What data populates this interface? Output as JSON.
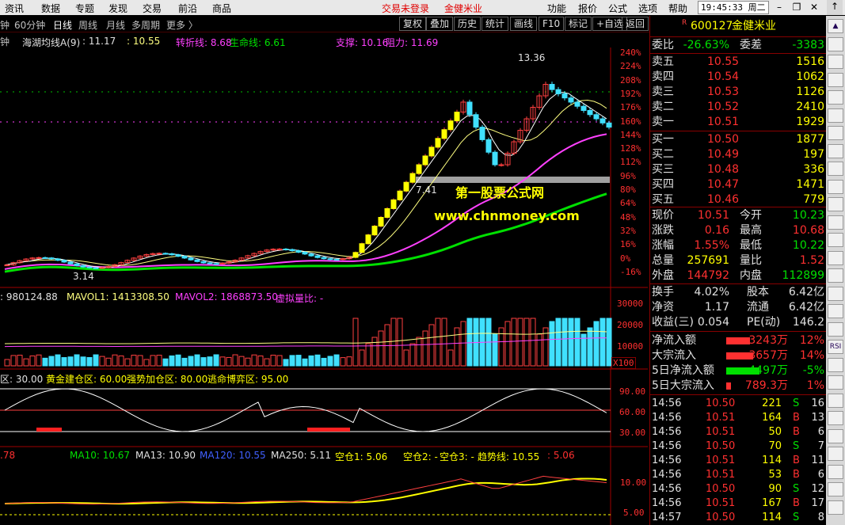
{
  "menu": {
    "items": [
      "资讯",
      "数据",
      "专题",
      "发现",
      "交易",
      "前沿",
      "商品"
    ],
    "status1": "交易未登录",
    "status2": "金健米业",
    "right": [
      "功能",
      "报价",
      "公式",
      "选项",
      "帮助"
    ],
    "time": "19:45:33",
    "day": "周二"
  },
  "periods": {
    "p0": "钟",
    "p1": "60分钟",
    "p2": "日线",
    "p3": "周线",
    "p4": "月线",
    "p5": "多周期",
    "p6": "更多 〉"
  },
  "toolbar": [
    "复权",
    "叠加",
    "历史",
    "统计",
    "画线",
    "F10",
    "标记",
    "+自选",
    "返回"
  ],
  "main_ind": {
    "name": "海湖均线A(9)",
    "v1": ": 11.17",
    "v2": ": 10.55",
    "v3": "转折线: 8.68",
    "v4": "生命线: 6.61",
    "v5": "支撑: 10.16",
    "v6": "阻力: 11.69"
  },
  "pct_axis": [
    "240%",
    "224%",
    "208%",
    "192%",
    "176%",
    "160%",
    "144%",
    "128%",
    "112%",
    "96%",
    "80%",
    "64%",
    "48%",
    "32%",
    "16%",
    "0%",
    "-16%"
  ],
  "price_labels": {
    "high": "13.36",
    "low": "3.14",
    "mid": "7.41"
  },
  "watermark": {
    "line1": "第一股票公式网",
    "line2": "www.chnmoney.com"
  },
  "vol_ind": {
    "v0": ": 980124.88",
    "v1": "MAVOL1: 1413308.50",
    "v2": "MAVOL2: 1868873.50",
    "v3": "虚拟量比: -"
  },
  "vol_axis": [
    "30000",
    "20000",
    "10000",
    "X100"
  ],
  "osc_ind": {
    "v0": "区: 30.00",
    "v1": "黄金建仓区: 60.00",
    "v2": "强势加仓区: 80.00",
    "v3": "逃命博弈区: 95.00"
  },
  "osc_axis": [
    "90.00",
    "60.00",
    "30.00"
  ],
  "ma_ind": {
    "v0": ".78",
    "v1": "MA10: 10.67",
    "v2": "MA13: 10.90",
    "v3": "MA120: 10.55",
    "v4": "MA250: 5.11",
    "v5": "空仓1: 5.06",
    "v6": "空仓2: -",
    "v7": "空仓3: -",
    "v8": "趋势线: 10.55",
    "v9": ": 5.06"
  },
  "ma_axis": [
    "10.00",
    "5.00"
  ],
  "stock": {
    "flag": "R",
    "code": "600127",
    "name": "金健米业"
  },
  "weibi": {
    "l1": "委比",
    "v1": "-26.63%",
    "l2": "委差",
    "v2": "-3383"
  },
  "asks": [
    {
      "l": "卖五",
      "p": "10.55",
      "v": "1516"
    },
    {
      "l": "卖四",
      "p": "10.54",
      "v": "1062"
    },
    {
      "l": "卖三",
      "p": "10.53",
      "v": "1126"
    },
    {
      "l": "卖二",
      "p": "10.52",
      "v": "2410"
    },
    {
      "l": "卖一",
      "p": "10.51",
      "v": "1929"
    }
  ],
  "bids": [
    {
      "l": "买一",
      "p": "10.50",
      "v": "1877"
    },
    {
      "l": "买二",
      "p": "10.49",
      "v": "197"
    },
    {
      "l": "买三",
      "p": "10.48",
      "v": "336"
    },
    {
      "l": "买四",
      "p": "10.47",
      "v": "1471"
    },
    {
      "l": "买五",
      "p": "10.46",
      "v": "779"
    }
  ],
  "quote": [
    {
      "l1": "现价",
      "v1": "10.51",
      "l2": "今开",
      "v2": "10.23"
    },
    {
      "l1": "涨跌",
      "v1": "0.16",
      "l2": "最高",
      "v2": "10.68"
    },
    {
      "l1": "涨幅",
      "v1": "1.55%",
      "l2": "最低",
      "v2": "10.22"
    },
    {
      "l1": "总量",
      "v1": "257691",
      "l2": "量比",
      "v2": "1.52"
    },
    {
      "l1": "外盘",
      "v1": "144792",
      "l2": "内盘",
      "v2": "112899"
    }
  ],
  "fund": [
    {
      "l1": "换手",
      "v1": "4.02%",
      "l2": "股本",
      "v2": "6.42亿"
    },
    {
      "l1": "净资",
      "v1": "1.17",
      "l2": "流通",
      "v2": "6.42亿"
    },
    {
      "l1": "收益(三)",
      "v1": "0.054",
      "l2": "PE(动)",
      "v2": "146.2"
    }
  ],
  "flow": [
    {
      "l": "净流入额",
      "v": "3243万",
      "p": "12%"
    },
    {
      "l": "大宗流入",
      "v": "3657万",
      "p": "14%"
    },
    {
      "l": "5日净流入额",
      "v": "-4497万",
      "p": "-5%"
    },
    {
      "l": "5日大宗流入",
      "v": "789.3万",
      "p": "1%"
    }
  ],
  "ticks": [
    {
      "t": "14:56",
      "p": "10.50",
      "v": "221",
      "s": "S",
      "n": "16"
    },
    {
      "t": "14:56",
      "p": "10.51",
      "v": "164",
      "s": "B",
      "n": "13"
    },
    {
      "t": "14:56",
      "p": "10.51",
      "v": "50",
      "s": "B",
      "n": "6"
    },
    {
      "t": "14:56",
      "p": "10.50",
      "v": "70",
      "s": "S",
      "n": "7"
    },
    {
      "t": "14:56",
      "p": "10.51",
      "v": "114",
      "s": "B",
      "n": "11"
    },
    {
      "t": "14:56",
      "p": "10.51",
      "v": "53",
      "s": "B",
      "n": "6"
    },
    {
      "t": "14:56",
      "p": "10.50",
      "v": "90",
      "s": "S",
      "n": "12"
    },
    {
      "t": "14:56",
      "p": "10.51",
      "v": "167",
      "s": "B",
      "n": "17"
    },
    {
      "t": "14:57",
      "p": "10.50",
      "v": "114",
      "s": "S",
      "n": "8"
    }
  ],
  "sidebar": [
    "▲",
    "",
    "",
    "",
    "",
    "",
    "",
    "",
    "",
    "",
    "",
    "",
    "",
    "",
    "",
    "",
    "",
    "",
    "RSI",
    "",
    "",
    "",
    "",
    "",
    "",
    "",
    "",
    ""
  ]
}
